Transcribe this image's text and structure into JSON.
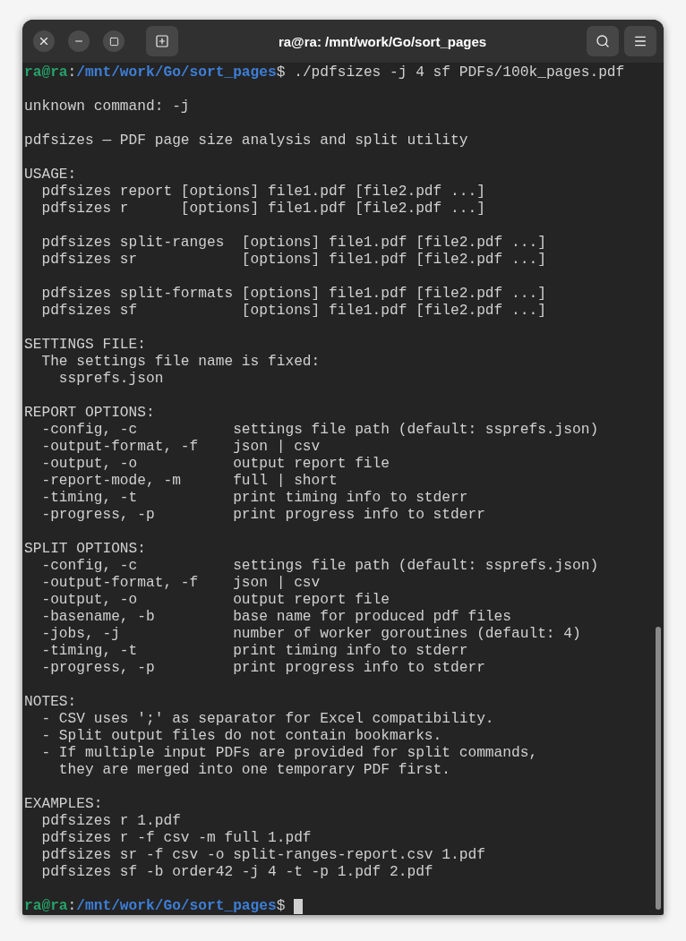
{
  "window": {
    "title": "ra@ra: /mnt/work/Go/sort_pages"
  },
  "lines": [
    {
      "kind": "prompt",
      "user": "ra@ra",
      "separator": ":",
      "path": "/mnt/work/Go/sort_pages",
      "symbol": "$",
      "command": " ./pdfsizes -j 4 sf PDFs/100k_pages.pdf"
    },
    {
      "kind": "blank"
    },
    {
      "kind": "output",
      "text": "unknown command: -j"
    },
    {
      "kind": "blank"
    },
    {
      "kind": "output",
      "text": "pdfsizes — PDF page size analysis and split utility"
    },
    {
      "kind": "blank"
    },
    {
      "kind": "output",
      "text": "USAGE:"
    },
    {
      "kind": "output",
      "text": "  pdfsizes report [options] file1.pdf [file2.pdf ...]"
    },
    {
      "kind": "output",
      "text": "  pdfsizes r      [options] file1.pdf [file2.pdf ...]"
    },
    {
      "kind": "blank"
    },
    {
      "kind": "output",
      "text": "  pdfsizes split-ranges  [options] file1.pdf [file2.pdf ...]"
    },
    {
      "kind": "output",
      "text": "  pdfsizes sr            [options] file1.pdf [file2.pdf ...]"
    },
    {
      "kind": "blank"
    },
    {
      "kind": "output",
      "text": "  pdfsizes split-formats [options] file1.pdf [file2.pdf ...]"
    },
    {
      "kind": "output",
      "text": "  pdfsizes sf            [options] file1.pdf [file2.pdf ...]"
    },
    {
      "kind": "blank"
    },
    {
      "kind": "output",
      "text": "SETTINGS FILE:"
    },
    {
      "kind": "output",
      "text": "  The settings file name is fixed:"
    },
    {
      "kind": "output",
      "text": "    ssprefs.json"
    },
    {
      "kind": "blank"
    },
    {
      "kind": "output",
      "text": "REPORT OPTIONS:"
    },
    {
      "kind": "output",
      "text": "  -config, -c           settings file path (default: ssprefs.json)"
    },
    {
      "kind": "output",
      "text": "  -output-format, -f    json | csv"
    },
    {
      "kind": "output",
      "text": "  -output, -o           output report file"
    },
    {
      "kind": "output",
      "text": "  -report-mode, -m      full | short"
    },
    {
      "kind": "output",
      "text": "  -timing, -t           print timing info to stderr"
    },
    {
      "kind": "output",
      "text": "  -progress, -p         print progress info to stderr"
    },
    {
      "kind": "blank"
    },
    {
      "kind": "output",
      "text": "SPLIT OPTIONS:"
    },
    {
      "kind": "output",
      "text": "  -config, -c           settings file path (default: ssprefs.json)"
    },
    {
      "kind": "output",
      "text": "  -output-format, -f    json | csv"
    },
    {
      "kind": "output",
      "text": "  -output, -o           output report file"
    },
    {
      "kind": "output",
      "text": "  -basename, -b         base name for produced pdf files"
    },
    {
      "kind": "output",
      "text": "  -jobs, -j             number of worker goroutines (default: 4)"
    },
    {
      "kind": "output",
      "text": "  -timing, -t           print timing info to stderr"
    },
    {
      "kind": "output",
      "text": "  -progress, -p         print progress info to stderr"
    },
    {
      "kind": "blank"
    },
    {
      "kind": "output",
      "text": "NOTES:"
    },
    {
      "kind": "output",
      "text": "  - CSV uses ';' as separator for Excel compatibility."
    },
    {
      "kind": "output",
      "text": "  - Split output files do not contain bookmarks."
    },
    {
      "kind": "output",
      "text": "  - If multiple input PDFs are provided for split commands,"
    },
    {
      "kind": "output",
      "text": "    they are merged into one temporary PDF first."
    },
    {
      "kind": "blank"
    },
    {
      "kind": "output",
      "text": "EXAMPLES:"
    },
    {
      "kind": "output",
      "text": "  pdfsizes r 1.pdf"
    },
    {
      "kind": "output",
      "text": "  pdfsizes r -f csv -m full 1.pdf"
    },
    {
      "kind": "output",
      "text": "  pdfsizes sr -f csv -o split-ranges-report.csv 1.pdf"
    },
    {
      "kind": "output",
      "text": "  pdfsizes sf -b order42 -j 4 -t -p 1.pdf 2.pdf"
    },
    {
      "kind": "blank"
    },
    {
      "kind": "prompt",
      "user": "ra@ra",
      "separator": ":",
      "path": "/mnt/work/Go/sort_pages",
      "symbol": "$",
      "cursor": true
    }
  ]
}
